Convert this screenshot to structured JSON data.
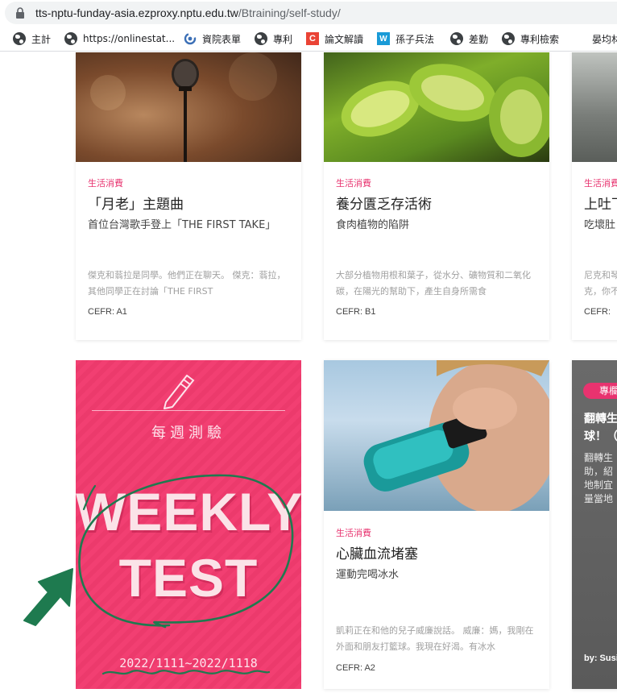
{
  "browser": {
    "url_host": "tts-nptu-funday-asia.ezproxy.nptu.edu.tw",
    "url_path": "/Btraining/self-study/"
  },
  "bookmarks": [
    {
      "label": "主計",
      "icon": "globe-icon"
    },
    {
      "label": "https://onlinestat...",
      "icon": "globe-icon"
    },
    {
      "label": "資院表單",
      "icon": "swirl-icon"
    },
    {
      "label": "專利",
      "icon": "globe-icon"
    },
    {
      "label": "論文解讀",
      "icon": "c-logo-icon"
    },
    {
      "label": "孫子兵法",
      "icon": "w-logo-icon"
    },
    {
      "label": "差勤",
      "icon": "globe-icon"
    },
    {
      "label": "專利檢索",
      "icon": "globe-icon"
    },
    {
      "label": "晏均林",
      "icon": ""
    }
  ],
  "cards_row1": [
    {
      "category": "生活消費",
      "title": "「月老」主題曲",
      "subtitle": "首位台灣歌手登上「THE FIRST TAKE」",
      "excerpt": "傑克和蓊拉是同學。他們正在聊天。 傑克：蓊拉，其他同學正在討論「THE FIRST",
      "cefr": "CEFR: A1"
    },
    {
      "category": "生活消費",
      "title": "養分匱乏存活術",
      "subtitle": "食肉植物的陷阱",
      "excerpt": "大部分植物用根和葉子，從水分、礦物質和二氧化碳，在陽光的幫助下，產生自身所需食",
      "cefr": "CEFR: B1"
    },
    {
      "category": "生活消費",
      "title": "上吐下",
      "subtitle": "吃壞肚",
      "excerpt": "尼克和琴克，你不",
      "cefr": "CEFR:"
    }
  ],
  "weekly_test": {
    "zh_title": "每週測驗",
    "line1": "WEEKLY",
    "line2": "TEST",
    "date_range": "2022/1111~2022/1118"
  },
  "card_row2_middle": {
    "category": "生活消費",
    "title": "心臟血流堵塞",
    "subtitle": "運動完喝冰水",
    "excerpt": "凱莉正在和他的兒子威廉說話。 威廉：媽，我剛在外面和朋友打籃球。我現在好渴。有冰水",
    "cefr": "CEFR: A2"
  },
  "card_row2_right": {
    "badge": "專欄",
    "title_line1": "翻轉生",
    "title_line2": "球！（",
    "body": [
      "翻轉生",
      "助，紹",
      "地制宜",
      "量當地"
    ],
    "author": "by: Susi"
  },
  "colors": {
    "category": "#e8336f",
    "weekly_bg": "#f23f72",
    "scribble": "#1e7a4f"
  }
}
